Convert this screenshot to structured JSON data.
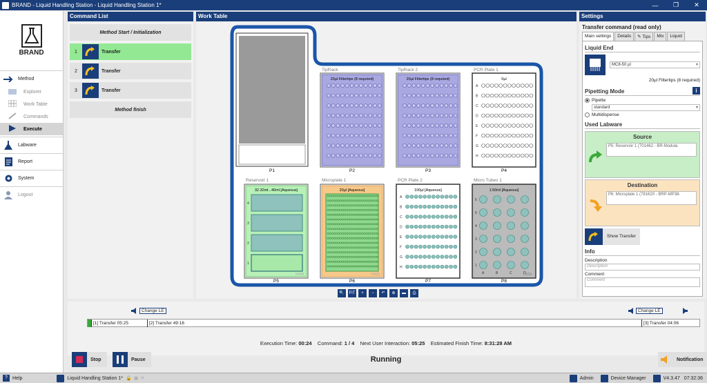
{
  "window": {
    "title": "BRAND - Liquid Handling Station - Liquid Handling Station 1*",
    "minimize": "—",
    "maximize": "❐",
    "close": "✕"
  },
  "nav": {
    "brand": "BRAND",
    "method": "Method",
    "explorer": "Explorer",
    "work_table": "Work Table",
    "commands": "Commands",
    "execute": "Execute",
    "labware": "Labware",
    "report": "Report",
    "system": "System",
    "logout": "Logout"
  },
  "command_list": {
    "title": "Command List",
    "start": "Method Start / Initialization",
    "items": [
      {
        "num": "1",
        "label": "Transfer"
      },
      {
        "num": "2",
        "label": "Transfer"
      },
      {
        "num": "3",
        "label": "Transfer"
      }
    ],
    "finish": "Method finish"
  },
  "work_table": {
    "title": "Work Table",
    "positions": {
      "p1": "P1",
      "p2": "P2",
      "p3": "P3",
      "p4": "P4",
      "p5": "P5",
      "p6": "P6",
      "p7": "P7",
      "p8": "P8"
    },
    "tiprack": {
      "name": "TipRack",
      "info": "20µl Filtertips (8 required)"
    },
    "tiprack2": {
      "name": "TipRack 2",
      "info": "20µl Filtertips (8 required)"
    },
    "pcr1": {
      "name": "PCR Plate 1",
      "info": "0µl"
    },
    "reservoir": {
      "name": "Reservoir 1",
      "info": "32.32ml...40ml [Aqueous]"
    },
    "microplate": {
      "name": "Microplate 1",
      "info": "20µl [Aqueous]"
    },
    "pcr2": {
      "name": "PCR Plate 2",
      "info": "100µl [Aqueous]"
    },
    "tubes": {
      "name": "Micro Tubes 1",
      "info": "1.50ml [Aqueous]"
    },
    "rows": [
      "A",
      "B",
      "C",
      "D",
      "E",
      "F",
      "G",
      "H"
    ],
    "tube_cols": [
      "A",
      "B",
      "C",
      "D"
    ],
    "tube_rows": [
      "6",
      "5",
      "4",
      "3",
      "2",
      "1"
    ],
    "res_rows": [
      "4",
      "3",
      "2",
      "1"
    ],
    "lbl_hamilton": "HAMI",
    "lbl_has": "HA3K",
    "toolbar": [
      "🔍",
      "FIT",
      "+",
      "−",
      "↶",
      "⊕",
      "▬",
      "⎙"
    ]
  },
  "settings": {
    "title": "Settings",
    "subtitle": "Transfer command (read only)",
    "tabs": [
      "Main settings",
      "Details",
      "✎ Tips",
      "Mix",
      "Liquid"
    ],
    "liquid_end": "Liquid End",
    "liquid_end_value": "MC8-50 µl",
    "filtertips": "20µl Filtertips (8 required)",
    "pipetting_mode": "Pipetting Mode",
    "pipette": "Pipette",
    "standard": "standard",
    "multidispense": "Multidispense",
    "used_labware": "Used Labware",
    "source": "Source",
    "source_value": "P5: Reservoir 1 (701462 - BR-Modula",
    "destination": "Destination",
    "destination_value": "P6: Microplate 1 (781620 - BRP-MP38-",
    "show_transfer": "Show Transfer",
    "info": "Info",
    "description": "Description",
    "description_ph": "Description",
    "comment": "Comment",
    "comment_ph": "Comment"
  },
  "timeline": {
    "change_le": "Change LE",
    "segments": [
      "[1] Transfer 05:25",
      "[2] Transfer 49:16",
      "[3] Transfer 04:06"
    ],
    "exec_time_label": "Execution Time:",
    "exec_time": "00:24",
    "command_label": "Command:",
    "command": "1 / 4",
    "next_label": "Next User Interaction:",
    "next": "05:25",
    "finish_label": "Estimated Finish Time:",
    "finish": "8:31:28 AM"
  },
  "controls": {
    "stop": "Stop",
    "pause": "Pause",
    "status": "Running",
    "notification": "Notification"
  },
  "status": {
    "help": "Help",
    "station": "Liquid Handling Station 1*",
    "user": "Admin",
    "device": "Device Manager",
    "version": "V4.3.47",
    "time": "07:32:36"
  }
}
